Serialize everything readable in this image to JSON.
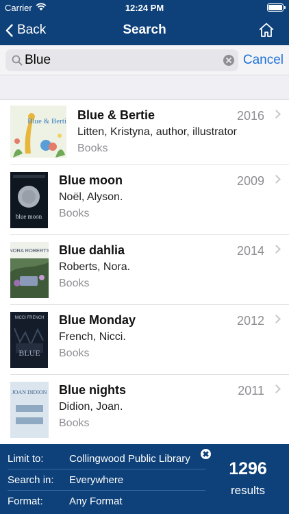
{
  "status_bar": {
    "carrier": "Carrier",
    "time": "12:24 PM"
  },
  "nav": {
    "back_label": "Back",
    "title": "Search"
  },
  "search": {
    "query": "Blue",
    "cancel_label": "Cancel"
  },
  "results": [
    {
      "title": "Blue & Bertie",
      "year": "2016",
      "author": "Litten, Kristyna, author, illustrator",
      "format": "Books",
      "cover": {
        "bg": "#eef2e4",
        "text": "Blue & Bertie",
        "accent": "#e8b63a"
      }
    },
    {
      "title": "Blue moon",
      "year": "2009",
      "author": "Noël, Alyson.",
      "format": "Books",
      "cover": {
        "bg": "#0e1620",
        "text": "blue moon",
        "accent": "#c6cbd2"
      }
    },
    {
      "title": "Blue dahlia",
      "year": "2014",
      "author": "Roberts, Nora.",
      "format": "Books",
      "cover": {
        "bg": "#5b7a52",
        "text": "NORA ROBERTS",
        "accent": "#8a9ab8"
      }
    },
    {
      "title": "Blue Monday",
      "year": "2012",
      "author": "French, Nicci.",
      "format": "Books",
      "cover": {
        "bg": "#141c2a",
        "text": "NICCI FRENCH",
        "accent": "#9aa8b8"
      }
    },
    {
      "title": "Blue nights",
      "year": "2011",
      "author": "Didion, Joan.",
      "format": "Books",
      "cover": {
        "bg": "#dbe5ee",
        "text": "JOAN DIDION",
        "accent": "#3b5e8a"
      }
    }
  ],
  "filters": {
    "limit": {
      "label": "Limit to:",
      "value": "Collingwood Public Library"
    },
    "search_in": {
      "label": "Search in:",
      "value": "Everywhere"
    },
    "format": {
      "label": "Format:",
      "value": "Any Format"
    }
  },
  "result_count": {
    "value": "1296",
    "label": "results"
  },
  "colors": {
    "brand": "#0e4179",
    "link": "#1d6fd8"
  }
}
